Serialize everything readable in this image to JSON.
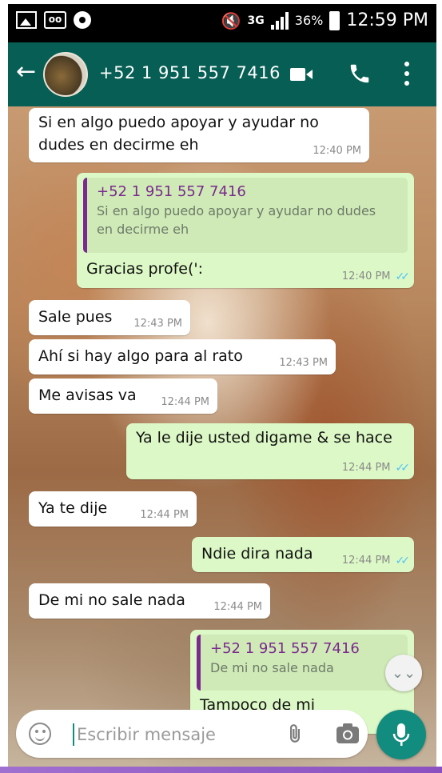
{
  "status_bar": {
    "network": "3G",
    "battery": "36%",
    "time": "12:59 PM"
  },
  "header": {
    "contact": "+52 1 951 557 7416",
    "back_icon": "back-arrow-icon",
    "video_icon": "video-call-icon",
    "call_icon": "phone-icon",
    "menu_icon": "more-vert-icon"
  },
  "messages": [
    {
      "dir": "in",
      "text_line1": "Si en algo puedo apoyar y ayudar no",
      "text_line2": "dudes en decirme eh",
      "time": "12:40 PM"
    },
    {
      "dir": "out",
      "quote_name": "+52 1 951 557 7416",
      "quote_line1": "Si en algo puedo apoyar y ayudar no dudes",
      "quote_line2": "en decirme eh",
      "text": "Gracias profe(':",
      "time": "12:40 PM"
    },
    {
      "dir": "in",
      "text": "Sale pues",
      "time": "12:43 PM"
    },
    {
      "dir": "in",
      "text": "Ahí si hay algo para al rato",
      "time": "12:43 PM"
    },
    {
      "dir": "in",
      "text": "Me avisas va",
      "time": "12:44 PM"
    },
    {
      "dir": "out",
      "text": "Ya le dije usted digame & se hace",
      "time": "12:44 PM"
    },
    {
      "dir": "in",
      "text": "Ya te dije",
      "time": "12:44 PM"
    },
    {
      "dir": "out",
      "text": "Ndie dira nada",
      "time": "12:44 PM"
    },
    {
      "dir": "in",
      "text": "De mi no sale nada",
      "time": "12:44 PM"
    },
    {
      "dir": "out",
      "quote_name": "+52 1 951 557 7416",
      "quote_line1": "De mi no sale nada",
      "text": "Tampoco de mi"
    }
  ],
  "composer": {
    "placeholder": "Escribir mensaje"
  },
  "colors": {
    "header": "#075e54",
    "incoming": "#ffffff",
    "outgoing": "#dcf8c6",
    "quote_accent": "#7a2a8e",
    "read_ticks": "#4fc3f7",
    "fab": "#128c7e"
  }
}
